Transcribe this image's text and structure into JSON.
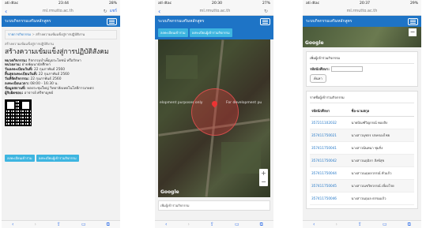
{
  "phone1": {
    "status": {
      "carrier": "ati dtac",
      "time": "23:44",
      "battery": "28%"
    },
    "url": "ml.rmutto.ac.th",
    "lang": "แชร์",
    "nav_title": "ระบบกิจกรรมเสริมหลักสูตร",
    "breadcrumb": {
      "home": "รายการกิจกรรม",
      "current": "สร้างความเข้มแข็งสู่การปฏิบัติงาน"
    },
    "subtitle": "สร้างความเข้มแข็งสู่การปฏิบัติงาน",
    "title": "สร้างความเข้มแข็งสู่การปฏิบัติสังคม",
    "details": [
      {
        "label": "หมวดกิจกรรม:",
        "value": "กิจกรรมบำเพ็ญประโยชน์ หรือรักษา"
      },
      {
        "label": "หน่วยงาน:",
        "value": "ฝ่ายพัฒนานักศึกษา"
      },
      {
        "label": "วันลงทะเบียนวันที่:",
        "value": "22 กุมภาพันธ์ 2560"
      },
      {
        "label": "สิ้นสุดลงทะเบียนวันที่:",
        "value": "22 กุมภาพันธ์ 2560"
      },
      {
        "label": "วันที่จัดกิจกรรม:",
        "value": "22 กุมภาพันธ์ 2560"
      },
      {
        "label": "ลงทะเบียนเวลา:",
        "value": "08:00 - 16:30 น."
      },
      {
        "label": "ข้อมูลสถานที่:",
        "value": "หอประชุมใหญ่ วิทยาลัยเทคโนโลยีการเกษตร"
      },
      {
        "label": "ผู้รับผิดชอบ:",
        "value": "อาจารย์ ศรีชาญชย์"
      }
    ],
    "btn_register": "ลงทะเบียนเข้าร่วม",
    "btn_checkin": "ลงทะเบียนผู้เข้าร่วมกิจกรรม"
  },
  "phone2": {
    "status": {
      "carrier": "atl dtac",
      "time": "20:30",
      "battery": "27%"
    },
    "url": "ml.rmutto.ac.th",
    "nav_title": "ระบบกิจกรรมเสริมหลักสูตร",
    "btn_register": "ลงทะเบียนเข้าร่วม",
    "btn_checkin": "ลงทะเบียนผู้เข้าร่วมกิจกรรม",
    "map_dev_left": "elopment purposes only",
    "map_dev_right": "For development pu",
    "google": "Google",
    "below": "เพิ่มผู้เข้าร่วมกิจกรรม"
  },
  "phone3": {
    "status": {
      "carrier": "ati dtac",
      "time": "20:37",
      "battery": "29%"
    },
    "url": "ml.rmutto.ac.th",
    "nav_title": "ระบบกิจกรรมเสริมหลักสูตร",
    "google": "Google",
    "search_card_title": "เพิ่มผู้เข้าร่วมกิจกรรม",
    "student_id_label": "รหัสนักศึกษา:",
    "search_btn": "ค้นหา",
    "list_title": "รายชื่อผู้เข้าร่วมกิจกรรม",
    "table_headers": [
      "รหัสนักศึกษา",
      "ชื่อ-นามสกุล"
    ],
    "rows": [
      {
        "id": "357211102032",
        "name": "นายปัณฑ์วิญกรณ์ ทองสิง"
      },
      {
        "id": "357411750021",
        "name": "นางสาวนุชกร ปกครองไชย"
      },
      {
        "id": "357411750041",
        "name": "นางสาวนันทนา ชุมกิ่ง"
      },
      {
        "id": "357411750042",
        "name": "นางสาวนฤมิลา สังข์สุข"
      },
      {
        "id": "357411750044",
        "name": "นางสาวณฤดลวรรณ์ ทัวแก้ว"
      },
      {
        "id": "357411750045",
        "name": "นางสาวณชวิทวรรณ์ เบื่องโรย"
      },
      {
        "id": "357411750046",
        "name": "นางสาวนฤมล ธรรมแก้ว"
      }
    ]
  }
}
